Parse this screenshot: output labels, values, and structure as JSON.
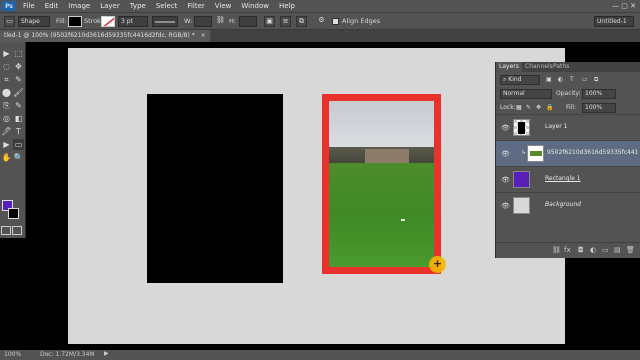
{
  "app": {
    "logo": "Ps"
  },
  "menu": [
    "File",
    "Edit",
    "Image",
    "Layer",
    "Type",
    "Select",
    "Filter",
    "View",
    "Window",
    "Help"
  ],
  "window_controls": "— ▢ ✕",
  "options_bar": {
    "tool_mode": "Shape",
    "fill_label": "Fill:",
    "stroke_label": "Stroke:",
    "stroke_width": "3 pt",
    "w_label": "W:",
    "h_label": "H:",
    "align_edges": "Align Edges",
    "workspace": "Untitled-1"
  },
  "document_tab": {
    "title": "tled-1 @ 100% (9502f6210d3616d59335fc4416d2fdc, RGB/8) *",
    "close": "×"
  },
  "colors": {
    "foreground": "#5a1fb8",
    "background": "#000000",
    "frame": "#e8322b"
  },
  "layers_panel": {
    "tabs": [
      "Layers",
      "Channels",
      "Paths"
    ],
    "filter": "Kind",
    "blend_mode": "Normal",
    "opacity_label": "Opacity:",
    "opacity": "100%",
    "lock_label": "Lock:",
    "fill_label": "Fill:",
    "fill": "100%",
    "layers": [
      {
        "name": "Layer 1",
        "thumb": "layer-mask"
      },
      {
        "name": "9502f6210d3616d59335fc4416...",
        "thumb": "photo"
      },
      {
        "name": "Rectangle 1",
        "thumb": "purple"
      },
      {
        "name": "Background",
        "thumb": "white"
      }
    ],
    "footer_icons": [
      "⛓",
      "fx",
      "◘",
      "◐",
      "▭",
      "▤",
      "🗑"
    ]
  },
  "status_bar": {
    "zoom": "100%",
    "doc": "Doc: 1.72M/3.34M",
    "arrow": "▶"
  },
  "tools": [
    "▶",
    "⬚",
    "◌",
    "✥",
    "⌗",
    "✎",
    "⬤",
    "🖌",
    "⎘",
    "✎",
    "◎",
    "◧",
    "🖊",
    "T",
    "▶",
    "▭",
    "✋",
    "🔍"
  ]
}
